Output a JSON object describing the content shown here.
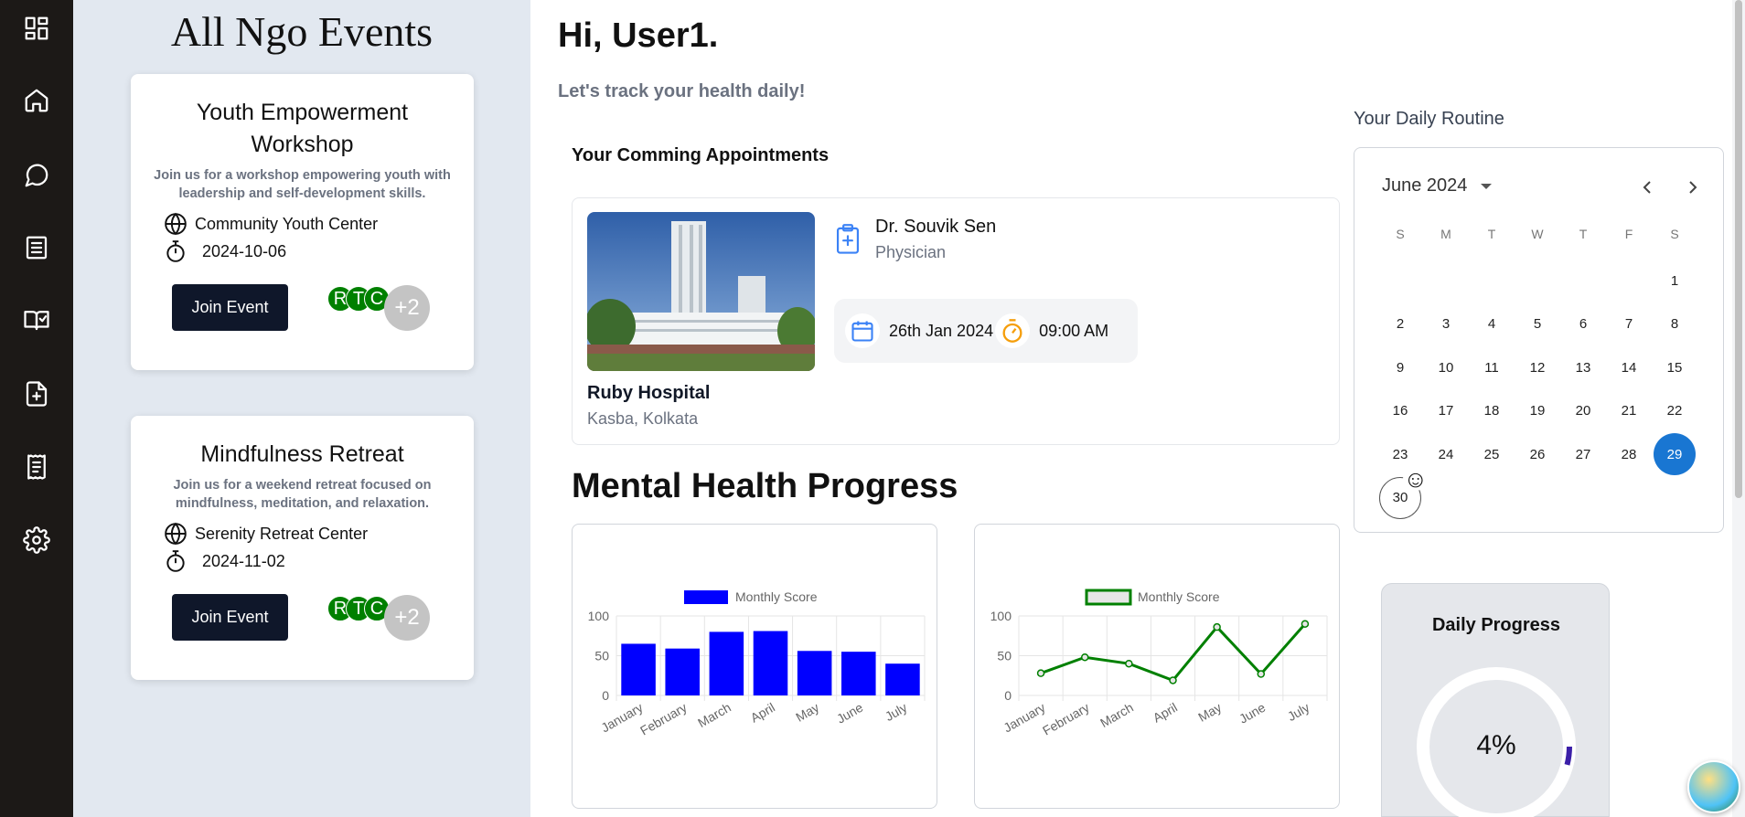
{
  "sidebar": {
    "icons": [
      "dashboard-icon",
      "home-icon",
      "chat-icon",
      "list-icon",
      "book-check-icon",
      "file-plus-icon",
      "receipt-icon",
      "gear-icon"
    ]
  },
  "events": {
    "title": "All Ngo Events",
    "items": [
      {
        "name": "Youth Empowerment Workshop",
        "description": "Join us for a workshop empowering youth with leadership and self-development skills.",
        "location": "Community Youth Center",
        "date": "2024-10-06",
        "button": "Join Event",
        "avatars": [
          "R",
          "T",
          "C"
        ],
        "more": "+2"
      },
      {
        "name": "Mindfulness Retreat",
        "description": "Join us for a weekend retreat focused on mindfulness, meditation, and relaxation.",
        "location": "Serenity Retreat Center",
        "date": "2024-11-02",
        "button": "Join Event",
        "avatars": [
          "R",
          "T",
          "C"
        ],
        "more": "+2"
      }
    ]
  },
  "main": {
    "greeting": "Hi, User1.",
    "subtitle": "Let's track your health daily!",
    "appointments_label": "Your Comming Appointments",
    "appointment": {
      "hospital": "Ruby Hospital",
      "location": "Kasba, Kolkata",
      "doctor": "Dr. Souvik Sen",
      "role": "Physician",
      "date": "26th Jan 2024",
      "time": "09:00 AM"
    },
    "mental_health_title": "Mental Health Progress"
  },
  "chart_data": [
    {
      "type": "bar",
      "categories": [
        "January",
        "February",
        "March",
        "April",
        "May",
        "June",
        "July"
      ],
      "series": [
        {
          "name": "Monthly Score",
          "values": [
            65,
            59,
            80,
            81,
            56,
            55,
            40
          ]
        }
      ],
      "yticks": [
        0,
        50,
        100
      ],
      "ylim": [
        0,
        100
      ],
      "color": "#0000ff",
      "grid": true,
      "legend": "top"
    },
    {
      "type": "line",
      "categories": [
        "January",
        "February",
        "March",
        "April",
        "May",
        "June",
        "July"
      ],
      "series": [
        {
          "name": "Monthly Score",
          "values": [
            28,
            48,
            40,
            19,
            86,
            27,
            90
          ]
        }
      ],
      "yticks": [
        0,
        50,
        100
      ],
      "ylim": [
        0,
        100
      ],
      "color": "#008000",
      "grid": true,
      "legend": "top"
    }
  ],
  "routine": {
    "label": "Your Daily Routine",
    "month": "June 2024",
    "weekdays": [
      "S",
      "M",
      "T",
      "W",
      "T",
      "F",
      "S"
    ],
    "first_weekday_index": 6,
    "days_in_month": 30,
    "selected_day": 29,
    "today_day": 30
  },
  "daily_progress": {
    "title": "Daily Progress",
    "percent_label": "4%",
    "percent": 4,
    "accent": "#3b1fa8"
  },
  "colors": {
    "sidebar": "#1c1917",
    "events_bg": "#e2e8f0",
    "button": "#0f172a",
    "calendar_selected": "#1976d2",
    "avatar": "#008000"
  }
}
